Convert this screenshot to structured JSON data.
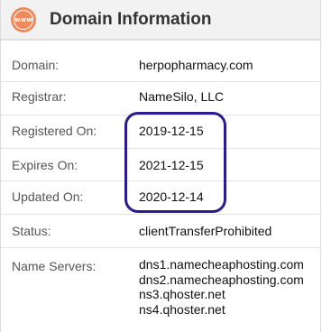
{
  "header": {
    "badge_text": "www",
    "title": "Domain Information",
    "accent_color": "#f08a5d"
  },
  "rows": [
    {
      "label": "Domain:",
      "value": "herpopharmacy.com"
    },
    {
      "label": "Registrar:",
      "value": "NameSilo, LLC"
    },
    {
      "label": "Registered On:",
      "value": "2019-12-15"
    },
    {
      "label": "Expires On:",
      "value": "2021-12-15"
    },
    {
      "label": "Updated On:",
      "value": "2020-12-14"
    },
    {
      "label": "Status:",
      "value": "clientTransferProhibited"
    }
  ],
  "name_servers": {
    "label": "Name Servers:",
    "values": [
      "dns1.namecheaphosting.com",
      "dns2.namecheaphosting.com",
      "ns3.qhoster.net",
      "ns4.qhoster.net"
    ]
  },
  "highlight_color": "#2c1b8f"
}
